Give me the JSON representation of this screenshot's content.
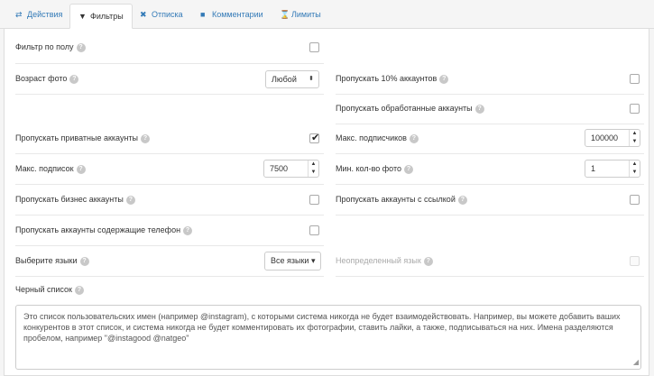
{
  "tabs": [
    {
      "label": "Действия",
      "icon": "⇄"
    },
    {
      "label": "Фильтры",
      "icon": "▼"
    },
    {
      "label": "Отписка",
      "icon": "✖"
    },
    {
      "label": "Комментарии",
      "icon": "■"
    },
    {
      "label": "Лимиты",
      "icon": "⌛"
    }
  ],
  "active_tab": "Фильтры",
  "help_glyph": "?",
  "left": {
    "gender_filter": {
      "label": "Фильтр по полу",
      "checked": false
    },
    "photo_age": {
      "label": "Возраст фото",
      "value": "Любой",
      "arrow": "⬍"
    },
    "skip_private": {
      "label": "Пропускать приватные аккаунты",
      "checked": true,
      "mark": "✔"
    },
    "max_following": {
      "label": "Макс. подписок",
      "value": "7500"
    },
    "skip_business": {
      "label": "Пропускать бизнес аккаунты",
      "checked": false
    },
    "skip_phone": {
      "label": "Пропускать аккаунты содержащие телефон",
      "checked": false
    },
    "languages": {
      "label": "Выберите языки",
      "value": "Все языки ▾"
    }
  },
  "right": {
    "skip_10pct": {
      "label": "Пропускать 10% аккаунтов",
      "checked": false
    },
    "skip_processed": {
      "label": "Пропускать обработанные аккаунты",
      "checked": false
    },
    "max_followers": {
      "label": "Макс. подписчиков",
      "value": "100000"
    },
    "min_photos": {
      "label": "Мин. кол-во фото",
      "value": "1"
    },
    "skip_with_link": {
      "label": "Пропускать аккаунты с ссылкой",
      "checked": false
    },
    "undefined_language": {
      "label": "Неопределенный язык",
      "checked": false,
      "disabled": true
    }
  },
  "blacklist": {
    "label": "Черный список",
    "placeholder": "Это список пользовательских имен (например @instagram), с которыми система никогда не будет взаимодействовать. Например, вы можете добавить ваших конкурентов в этот список, и система никогда не будет комментировать их фотографии, ставить лайки, а также, подписываться на них. Имена разделяются пробелом, например \"@instagood @natgeo\""
  },
  "spinner": {
    "up": "▲",
    "down": "▼"
  },
  "resize_grip": "◢",
  "colors": {
    "link": "#337ab7",
    "text": "#333333",
    "border": "#dddddd",
    "help": "#c8c8c8"
  }
}
